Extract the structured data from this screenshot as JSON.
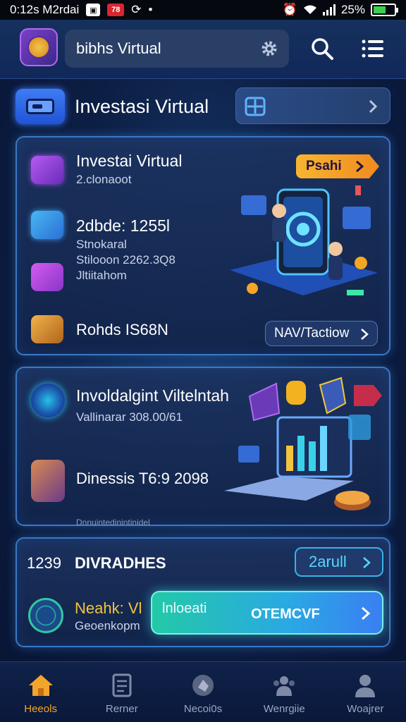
{
  "status_bar": {
    "time": "0:12s M2rdai",
    "badge_red": "78",
    "battery": "25%"
  },
  "header": {
    "title": "bibhs Virtual"
  },
  "section": {
    "title": "Investasi Virtual"
  },
  "card1": {
    "title": "Investai Virtual",
    "subtitle": "2.clonaoot",
    "action_label": "Psahi",
    "line1": "2dbde: 1255l",
    "line2": "Stnokaral",
    "line3": "Stilooon 2262.3Q8",
    "line4": "Jltiitahom",
    "line5": "Rohds IS68N",
    "link_label": "NAV/Tactiow"
  },
  "card2": {
    "title": "Involdalgint Viltelntah",
    "subtitle": "Vallinarar 308.00/61",
    "line2": "Dinessis T6:9 2098",
    "footer_cut": "Dnnuintedinintinidel"
  },
  "card3": {
    "number": "1239",
    "title": "DIVRADHES",
    "button_label": "2arull",
    "item_title": "Neahk: Vl",
    "item_sub": "Geoenkopm",
    "cta_left": "lnloeati",
    "cta_right": "OTEMCVF"
  },
  "bottom_nav": [
    {
      "label": "Heeols",
      "icon": "home-icon",
      "active": true
    },
    {
      "label": "Rerner",
      "icon": "document-icon",
      "active": false
    },
    {
      "label": "Necoi0s",
      "icon": "gem-icon",
      "active": false
    },
    {
      "label": "Wenrgiie",
      "icon": "group-icon",
      "active": false
    },
    {
      "label": "Woajrer",
      "icon": "person-icon",
      "active": false
    }
  ],
  "colors": {
    "accent_orange": "#f7b531",
    "accent_blue": "#3a79ff",
    "accent_cyan": "#2ac6e0",
    "card_border": "#3a78c6"
  }
}
